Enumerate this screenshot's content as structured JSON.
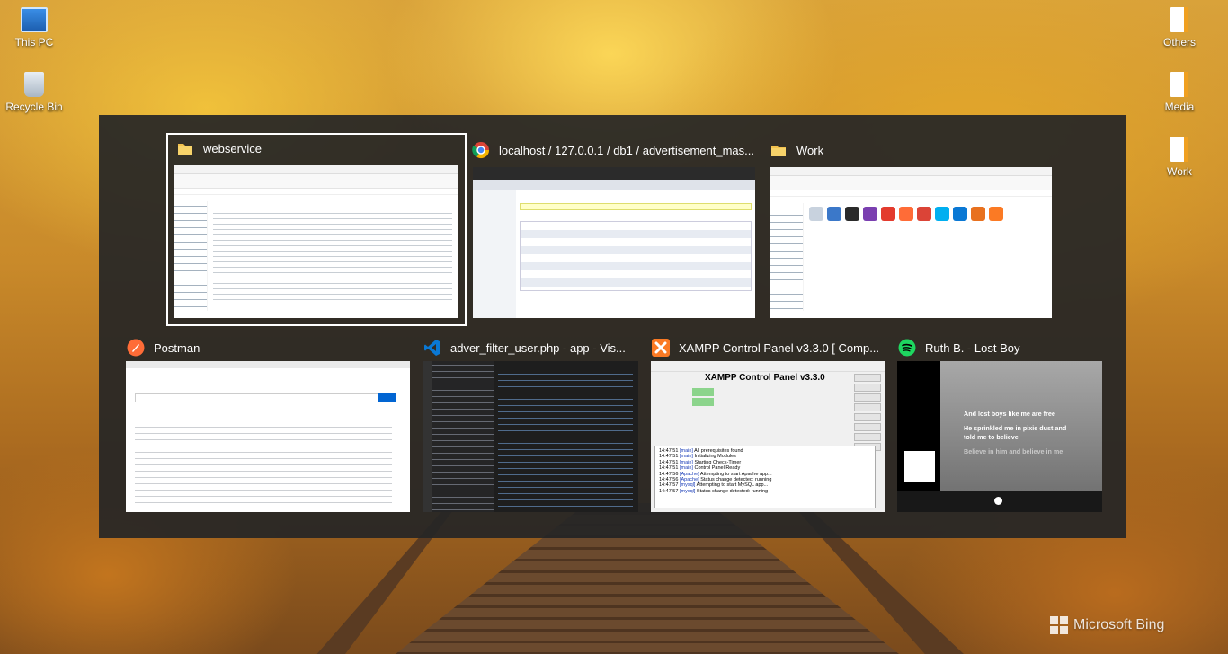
{
  "desktop": {
    "icons_left": [
      {
        "label": "This PC",
        "icon": "this-pc-icon"
      },
      {
        "label": "Recycle Bin",
        "icon": "recycle-bin-icon"
      }
    ],
    "icons_right": [
      {
        "label": "Others",
        "icon": "text-file-icon"
      },
      {
        "label": "Media",
        "icon": "text-file-icon"
      },
      {
        "label": "Work",
        "icon": "text-file-icon"
      }
    ],
    "watermark": "Microsoft Bing"
  },
  "switcher": {
    "windows": [
      {
        "title": "webservice",
        "icon": "folder-icon",
        "selected": true
      },
      {
        "title": "localhost / 127.0.0.1 / db1 / advertisement_mas...",
        "icon": "chrome-icon"
      },
      {
        "title": "Work",
        "icon": "folder-icon"
      },
      {
        "title": "Postman",
        "icon": "postman-icon"
      },
      {
        "title": "adver_filter_user.php - app - Vis...",
        "icon": "vscode-icon"
      },
      {
        "title": "XAMPP Control Panel v3.3.0   [ Comp...",
        "icon": "xampp-icon"
      },
      {
        "title": "Ruth B. - Lost Boy",
        "icon": "spotify-icon"
      }
    ],
    "xampp_thumb": {
      "heading": "XAMPP Control Panel v3.3.0",
      "log": [
        {
          "time": "14:47:51",
          "module": "[main]",
          "msg": "All prerequisites found"
        },
        {
          "time": "14:47:51",
          "module": "[main]",
          "msg": "Initializing Modules"
        },
        {
          "time": "14:47:51",
          "module": "[main]",
          "msg": "Starting Check-Timer"
        },
        {
          "time": "14:47:51",
          "module": "[main]",
          "msg": "Control Panel Ready"
        },
        {
          "time": "14:47:56",
          "module": "[Apache]",
          "msg": "Attempting to start Apache app..."
        },
        {
          "time": "14:47:56",
          "module": "[Apache]",
          "msg": "Status change detected: running"
        },
        {
          "time": "14:47:57",
          "module": "[mysql]",
          "msg": "Attempting to start MySQL app..."
        },
        {
          "time": "14:47:57",
          "module": "[mysql]",
          "msg": "Status change detected: running"
        }
      ]
    },
    "spotify_thumb": {
      "lyrics_active": [
        "And lost boys like me are free",
        "He sprinkled me in pixie dust and",
        "told me to believe"
      ],
      "lyrics_next": "Believe in him and believe in me"
    }
  },
  "colors": {
    "switcher_bg": "#262626",
    "selection": "#ffffff",
    "folder": "#f2c14e",
    "postman": "#ff6c37",
    "vscode": "#0a78d4",
    "xampp": "#fb7a24",
    "spotify": "#1ed760"
  }
}
